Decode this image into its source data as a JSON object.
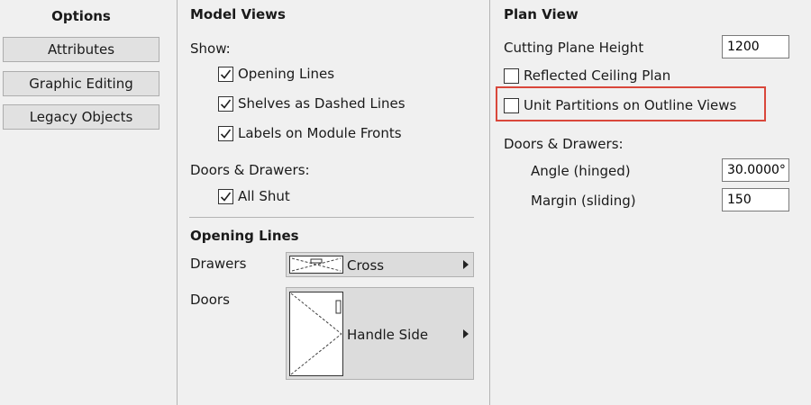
{
  "sidebar": {
    "title": "Options",
    "buttons": [
      "Attributes",
      "Graphic Editing",
      "Legacy Objects"
    ]
  },
  "model_views": {
    "title": "Model Views",
    "show_label": "Show:",
    "show_items": [
      {
        "label": "Opening Lines",
        "checked": true
      },
      {
        "label": "Shelves as Dashed Lines",
        "checked": true
      },
      {
        "label": "Labels on Module Fronts",
        "checked": true
      }
    ],
    "doors_drawers_label": "Doors & Drawers:",
    "all_shut": {
      "label": "All Shut",
      "checked": true
    }
  },
  "opening_lines": {
    "title": "Opening Lines",
    "drawers_label": "Drawers",
    "drawers_value": "Cross",
    "doors_label": "Doors",
    "doors_value": "Handle Side"
  },
  "plan_view": {
    "title": "Plan View",
    "cutting_plane_label": "Cutting Plane Height",
    "cutting_plane_value": "1200",
    "reflected_ceiling": {
      "label": "Reflected Ceiling Plan",
      "checked": false
    },
    "unit_partitions": {
      "label": "Unit Partitions on Outline Views",
      "checked": false
    },
    "doors_drawers_label": "Doors & Drawers:",
    "angle_label": "Angle (hinged)",
    "angle_value": "30.0000°",
    "margin_label": "Margin (sliding)",
    "margin_value": "150"
  },
  "colors": {
    "highlight": "#d9473b",
    "background": "#f0f0f0"
  }
}
